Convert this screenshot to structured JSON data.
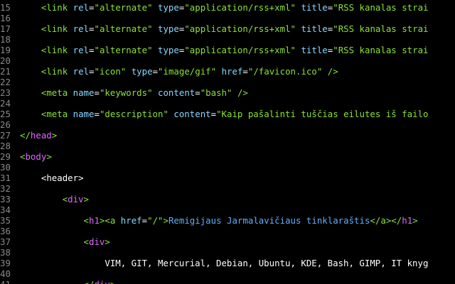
{
  "editor": {
    "colors": {
      "background": "#000000",
      "line_number": "#8a8a8a",
      "tag": "#8ae234",
      "attr": "#87d7ff",
      "string": "#8ae234",
      "text": "#ffffff",
      "punct": "#ffffff",
      "keyword": "#e066ff",
      "link": "#5fafff"
    },
    "lines": [
      {
        "num": "15",
        "indent": 2,
        "tokens": [
          {
            "t": "<",
            "c": "tag"
          },
          {
            "t": "link",
            "c": "tag"
          },
          {
            "t": " ",
            "c": "text"
          },
          {
            "t": "rel",
            "c": "attr"
          },
          {
            "t": "=",
            "c": "punct"
          },
          {
            "t": "\"alternate\"",
            "c": "string"
          },
          {
            "t": " ",
            "c": "text"
          },
          {
            "t": "type",
            "c": "attr"
          },
          {
            "t": "=",
            "c": "punct"
          },
          {
            "t": "\"application/rss+xml\"",
            "c": "string"
          },
          {
            "t": " ",
            "c": "text"
          },
          {
            "t": "title",
            "c": "attr"
          },
          {
            "t": "=",
            "c": "punct"
          },
          {
            "t": "\"RSS kanalas strai",
            "c": "string"
          }
        ]
      },
      {
        "num": "16",
        "indent": 0,
        "tokens": []
      },
      {
        "num": "17",
        "indent": 2,
        "tokens": [
          {
            "t": "<",
            "c": "tag"
          },
          {
            "t": "link",
            "c": "tag"
          },
          {
            "t": " ",
            "c": "text"
          },
          {
            "t": "rel",
            "c": "attr"
          },
          {
            "t": "=",
            "c": "punct"
          },
          {
            "t": "\"alternate\"",
            "c": "string"
          },
          {
            "t": " ",
            "c": "text"
          },
          {
            "t": "type",
            "c": "attr"
          },
          {
            "t": "=",
            "c": "punct"
          },
          {
            "t": "\"application/rss+xml\"",
            "c": "string"
          },
          {
            "t": " ",
            "c": "text"
          },
          {
            "t": "title",
            "c": "attr"
          },
          {
            "t": "=",
            "c": "punct"
          },
          {
            "t": "\"RSS kanalas strai",
            "c": "string"
          }
        ]
      },
      {
        "num": "18",
        "indent": 0,
        "tokens": []
      },
      {
        "num": "19",
        "indent": 2,
        "tokens": [
          {
            "t": "<",
            "c": "tag"
          },
          {
            "t": "link",
            "c": "tag"
          },
          {
            "t": " ",
            "c": "text"
          },
          {
            "t": "rel",
            "c": "attr"
          },
          {
            "t": "=",
            "c": "punct"
          },
          {
            "t": "\"alternate\"",
            "c": "string"
          },
          {
            "t": " ",
            "c": "text"
          },
          {
            "t": "type",
            "c": "attr"
          },
          {
            "t": "=",
            "c": "punct"
          },
          {
            "t": "\"application/rss+xml\"",
            "c": "string"
          },
          {
            "t": " ",
            "c": "text"
          },
          {
            "t": "title",
            "c": "attr"
          },
          {
            "t": "=",
            "c": "punct"
          },
          {
            "t": "\"RSS kanalas strai",
            "c": "string"
          }
        ]
      },
      {
        "num": "20",
        "indent": 0,
        "tokens": []
      },
      {
        "num": "21",
        "indent": 2,
        "tokens": [
          {
            "t": "<",
            "c": "tag"
          },
          {
            "t": "link",
            "c": "tag"
          },
          {
            "t": " ",
            "c": "text"
          },
          {
            "t": "rel",
            "c": "attr"
          },
          {
            "t": "=",
            "c": "punct"
          },
          {
            "t": "\"icon\"",
            "c": "string"
          },
          {
            "t": " ",
            "c": "text"
          },
          {
            "t": "type",
            "c": "attr"
          },
          {
            "t": "=",
            "c": "punct"
          },
          {
            "t": "\"image/gif\"",
            "c": "string"
          },
          {
            "t": " ",
            "c": "text"
          },
          {
            "t": "href",
            "c": "attr"
          },
          {
            "t": "=",
            "c": "punct"
          },
          {
            "t": "\"/favicon.ico\"",
            "c": "string"
          },
          {
            "t": " ",
            "c": "text"
          },
          {
            "t": "/>",
            "c": "tag"
          }
        ]
      },
      {
        "num": "22",
        "indent": 0,
        "tokens": []
      },
      {
        "num": "23",
        "indent": 2,
        "tokens": [
          {
            "t": "<",
            "c": "tag"
          },
          {
            "t": "meta",
            "c": "tag"
          },
          {
            "t": " ",
            "c": "text"
          },
          {
            "t": "name",
            "c": "attr"
          },
          {
            "t": "=",
            "c": "punct"
          },
          {
            "t": "\"keywords\"",
            "c": "string"
          },
          {
            "t": " ",
            "c": "text"
          },
          {
            "t": "content",
            "c": "attr"
          },
          {
            "t": "=",
            "c": "punct"
          },
          {
            "t": "\"bash\"",
            "c": "string"
          },
          {
            "t": " ",
            "c": "text"
          },
          {
            "t": "/>",
            "c": "tag"
          }
        ]
      },
      {
        "num": "24",
        "indent": 0,
        "tokens": []
      },
      {
        "num": "25",
        "indent": 2,
        "tokens": [
          {
            "t": "<",
            "c": "tag"
          },
          {
            "t": "meta",
            "c": "tag"
          },
          {
            "t": " ",
            "c": "text"
          },
          {
            "t": "name",
            "c": "attr"
          },
          {
            "t": "=",
            "c": "punct"
          },
          {
            "t": "\"description\"",
            "c": "string"
          },
          {
            "t": " ",
            "c": "text"
          },
          {
            "t": "content",
            "c": "attr"
          },
          {
            "t": "=",
            "c": "punct"
          },
          {
            "t": "\"Kaip pašalinti tuščias eilutes iš failo",
            "c": "string"
          }
        ]
      },
      {
        "num": "26",
        "indent": 0,
        "tokens": []
      },
      {
        "num": "27",
        "indent": 0,
        "tokens": [
          {
            "t": "</",
            "c": "tag"
          },
          {
            "t": "head",
            "c": "keyword"
          },
          {
            "t": ">",
            "c": "tag"
          }
        ]
      },
      {
        "num": "28",
        "indent": 0,
        "tokens": []
      },
      {
        "num": "29",
        "indent": 0,
        "tokens": [
          {
            "t": "<",
            "c": "tag"
          },
          {
            "t": "body",
            "c": "keyword"
          },
          {
            "t": ">",
            "c": "tag"
          }
        ]
      },
      {
        "num": "30",
        "indent": 0,
        "tokens": []
      },
      {
        "num": "31",
        "indent": 2,
        "tokens": [
          {
            "t": "<",
            "c": "text"
          },
          {
            "t": "header",
            "c": "text"
          },
          {
            "t": ">",
            "c": "text"
          }
        ]
      },
      {
        "num": "32",
        "indent": 0,
        "tokens": []
      },
      {
        "num": "33",
        "indent": 4,
        "tokens": [
          {
            "t": "<",
            "c": "tag"
          },
          {
            "t": "div",
            "c": "keyword"
          },
          {
            "t": ">",
            "c": "tag"
          }
        ]
      },
      {
        "num": "34",
        "indent": 0,
        "tokens": []
      },
      {
        "num": "35",
        "indent": 6,
        "tokens": [
          {
            "t": "<",
            "c": "tag"
          },
          {
            "t": "h1",
            "c": "keyword"
          },
          {
            "t": ">",
            "c": "tag"
          },
          {
            "t": "<",
            "c": "tag"
          },
          {
            "t": "a",
            "c": "tag"
          },
          {
            "t": " ",
            "c": "text"
          },
          {
            "t": "href",
            "c": "attr"
          },
          {
            "t": "=",
            "c": "punct"
          },
          {
            "t": "\"/\"",
            "c": "string"
          },
          {
            "t": ">",
            "c": "tag"
          },
          {
            "t": "Remigijaus Jarmalavičiaus tinklaraštis",
            "c": "link"
          },
          {
            "t": "</",
            "c": "tag"
          },
          {
            "t": "a",
            "c": "tag"
          },
          {
            "t": ">",
            "c": "tag"
          },
          {
            "t": "</",
            "c": "tag"
          },
          {
            "t": "h1",
            "c": "keyword"
          },
          {
            "t": ">",
            "c": "tag"
          }
        ]
      },
      {
        "num": "36",
        "indent": 0,
        "tokens": []
      },
      {
        "num": "37",
        "indent": 6,
        "tokens": [
          {
            "t": "<",
            "c": "tag"
          },
          {
            "t": "div",
            "c": "keyword"
          },
          {
            "t": ">",
            "c": "tag"
          }
        ]
      },
      {
        "num": "38",
        "indent": 0,
        "tokens": []
      },
      {
        "num": "39",
        "indent": 8,
        "tokens": [
          {
            "t": "VIM, GIT, Mercurial, Debian, Ubuntu, KDE, Bash, GIMP, IT knyg",
            "c": "text"
          }
        ]
      },
      {
        "num": "40",
        "indent": 0,
        "tokens": []
      },
      {
        "num": "41",
        "indent": 6,
        "tokens": [
          {
            "t": "</",
            "c": "tag"
          },
          {
            "t": "div",
            "c": "keyword"
          },
          {
            "t": ">",
            "c": "tag"
          }
        ]
      }
    ]
  }
}
